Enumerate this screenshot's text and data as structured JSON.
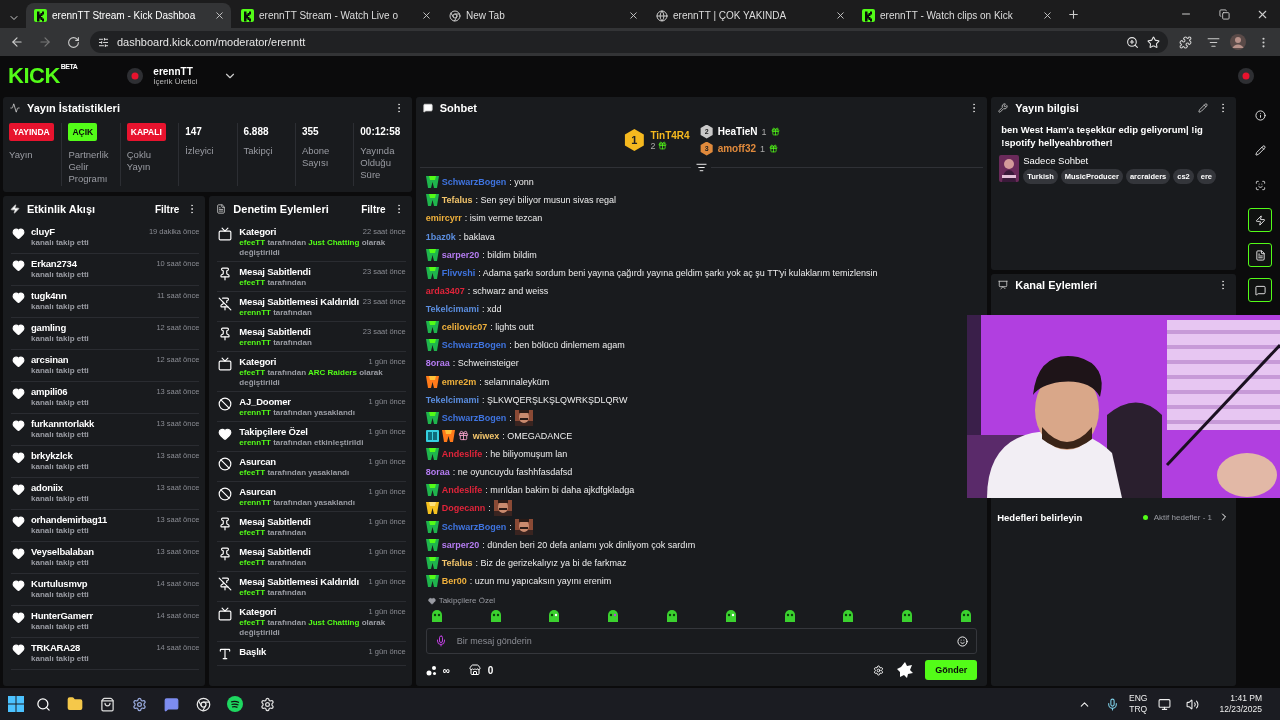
{
  "browser": {
    "tabs": [
      {
        "title": "erennTT Stream - Kick Dashboa",
        "kind": "kick",
        "selected": true
      },
      {
        "title": "erennTT Stream - Watch Live o",
        "kind": "kick",
        "selected": false
      },
      {
        "title": "New Tab",
        "kind": "chrome",
        "selected": false
      },
      {
        "title": "erennTT | ÇOK YAKINDA",
        "kind": "globe",
        "selected": false
      },
      {
        "title": "erennTT - Watch clips on Kick",
        "kind": "kick",
        "selected": false
      }
    ],
    "url": "dashboard.kick.com/moderator/erenntt"
  },
  "header": {
    "logo": "KICK",
    "logo_tag": "BETA",
    "user": "erennTT",
    "role": "İçerik Üretici"
  },
  "stats": {
    "title": "Yayın İstatistikleri",
    "items": [
      {
        "kind": "badge",
        "badge": "YAYINDA",
        "color": "#e8132e",
        "label": "Yayın"
      },
      {
        "kind": "badge",
        "badge": "AÇIK",
        "color": "#53fc18",
        "label": "Partnerlik Gelir Programı"
      },
      {
        "kind": "badge",
        "badge": "KAPALI",
        "color": "#e8132e",
        "label": "Çoklu Yayın"
      },
      {
        "kind": "value",
        "value": "147",
        "label": "İzleyici"
      },
      {
        "kind": "value",
        "value": "6.888",
        "label": "Takipçi"
      },
      {
        "kind": "value",
        "value": "355",
        "label": "Abone Sayısı"
      },
      {
        "kind": "value",
        "value": "00:12:58",
        "label": "Yayında Olduğu Süre"
      }
    ]
  },
  "activity": {
    "title": "Etkinlik Akışı",
    "filter": "Filtre",
    "items": [
      {
        "user": "cluyF",
        "text": "kanalı takip etti",
        "time": "19 dakika önce"
      },
      {
        "user": "Erkan2734",
        "text": "kanalı takip etti",
        "time": "10 saat önce"
      },
      {
        "user": "tugk4nn",
        "text": "kanalı takip etti",
        "time": "11 saat önce"
      },
      {
        "user": "gamling",
        "text": "kanalı takip etti",
        "time": "12 saat önce"
      },
      {
        "user": "arcsinan",
        "text": "kanalı takip etti",
        "time": "12 saat önce"
      },
      {
        "user": "ampili06",
        "text": "kanalı takip etti",
        "time": "13 saat önce"
      },
      {
        "user": "furkanntorlakk",
        "text": "kanalı takip etti",
        "time": "13 saat önce"
      },
      {
        "user": "brkykzlck",
        "text": "kanalı takip etti",
        "time": "13 saat önce"
      },
      {
        "user": "adoniix",
        "text": "kanalı takip etti",
        "time": "13 saat önce"
      },
      {
        "user": "orhandemirbag11",
        "text": "kanalı takip etti",
        "time": "13 saat önce"
      },
      {
        "user": "Veyselbalaban",
        "text": "kanalı takip etti",
        "time": "13 saat önce"
      },
      {
        "user": "Kurtulusmvp",
        "text": "kanalı takip etti",
        "time": "14 saat önce"
      },
      {
        "user": "HunterGamerr",
        "text": "kanalı takip etti",
        "time": "14 saat önce"
      },
      {
        "user": "TRKARA28",
        "text": "kanalı takip etti",
        "time": "14 saat önce"
      }
    ]
  },
  "moderation": {
    "title": "Denetim Eylemleri",
    "filter": "Filtre",
    "items": [
      {
        "kind": "category",
        "title": "Kategori",
        "time": "22 saat önce",
        "actor": "efeeTT",
        "text": "tarafından",
        "target": "Just Chatting",
        "suffix": "olarak değiştirildi"
      },
      {
        "kind": "pin",
        "title": "Mesaj Sabitlendi",
        "time": "23 saat önce",
        "actor": "efeeTT",
        "text": "tarafından"
      },
      {
        "kind": "unpin",
        "title": "Mesaj Sabitlemesi Kaldırıldı",
        "time": "23 saat önce",
        "actor": "erennTT",
        "text": "tarafından"
      },
      {
        "kind": "pin",
        "title": "Mesaj Sabitlendi",
        "time": "23 saat önce",
        "actor": "erennTT",
        "text": "tarafından"
      },
      {
        "kind": "category",
        "title": "Kategori",
        "time": "1 gün önce",
        "actor": "efeeTT",
        "text": "tarafından",
        "target": "ARC Raiders",
        "suffix": "olarak değiştirildi"
      },
      {
        "kind": "ban",
        "title": "AJ_Doomer",
        "time": "1 gün önce",
        "actor": "erennTT",
        "text": "tarafından yasaklandı"
      },
      {
        "kind": "heart",
        "title": "Takipçilere Özel",
        "time": "1 gün önce",
        "actor": "erennTT",
        "text": "tarafından etkinleştirildi"
      },
      {
        "kind": "ban",
        "title": "Asurcan",
        "time": "1 gün önce",
        "actor": "efeeTT",
        "text": "tarafından yasaklandı"
      },
      {
        "kind": "ban",
        "title": "Asurcan",
        "time": "1 gün önce",
        "actor": "erennTT",
        "text": "tarafından yasaklandı"
      },
      {
        "kind": "pin",
        "title": "Mesaj Sabitlendi",
        "time": "1 gün önce",
        "actor": "efeeTT",
        "text": "tarafından"
      },
      {
        "kind": "pin",
        "title": "Mesaj Sabitlendi",
        "time": "1 gün önce",
        "actor": "efeeTT",
        "text": "tarafından"
      },
      {
        "kind": "unpin",
        "title": "Mesaj Sabitlemesi Kaldırıldı",
        "time": "1 gün önce",
        "actor": "efeeTT",
        "text": "tarafından"
      },
      {
        "kind": "category",
        "title": "Kategori",
        "time": "1 gün önce",
        "actor": "efeeTT",
        "text": "tarafından",
        "target": "Just Chatting",
        "suffix": "olarak değiştirildi"
      },
      {
        "kind": "title",
        "title": "Başlık",
        "time": "1 gün önce"
      }
    ]
  },
  "chat": {
    "title": "Sohbet",
    "leaders": [
      {
        "rank": "1",
        "name": "TinT4R4",
        "count": "2",
        "color": "#f5b91f"
      },
      {
        "rank": "2",
        "name": "HeaTieN",
        "count": "1",
        "color": "#c9c9c9"
      },
      {
        "rank": "3",
        "name": "amoff32",
        "count": "1",
        "color": "#e08a3c"
      }
    ],
    "messages": [
      {
        "badges": [
          {
            "kind": "sub"
          }
        ],
        "user": "SchwarzBogen",
        "color": "#3f74e0",
        "kind": "text",
        "text": ": yonn"
      },
      {
        "badges": [
          {
            "kind": "sub"
          }
        ],
        "user": "Tefalus",
        "color": "#f2c46b",
        "kind": "text",
        "text": ": Sen şeyi biliyor musun sivas regal"
      },
      {
        "user": "emircyrr",
        "color": "#f0b13c",
        "kind": "text",
        "text": ": isim verme tezcan"
      },
      {
        "user": "1baz0k",
        "color": "#5b8ee0",
        "kind": "text",
        "text": ": baklava"
      },
      {
        "badges": [
          {
            "kind": "sub"
          }
        ],
        "user": "sarper20",
        "color": "#b57cf2",
        "kind": "text",
        "text": ": bildim bildim"
      },
      {
        "badges": [
          {
            "kind": "sub"
          }
        ],
        "user": "Flivvshi",
        "color": "#3f74e0",
        "kind": "text",
        "text": ": Adama şarkı sordum beni yayına çağırdı yayına geldim şarkı yok aç şu TT'yi kulaklarım temizlensin"
      },
      {
        "user": "arda3407",
        "color": "#e0243a",
        "kind": "text",
        "text": ": schwarz and weiss"
      },
      {
        "user": "Tekelcimami",
        "color": "#5b8ee0",
        "kind": "text",
        "text": ": xdd"
      },
      {
        "badges": [
          {
            "kind": "sub"
          }
        ],
        "user": "celilovic07",
        "color": "#f0b13c",
        "kind": "text",
        "text": ": lights outt"
      },
      {
        "badges": [
          {
            "kind": "sub"
          }
        ],
        "user": "SchwarzBogen",
        "color": "#3f74e0",
        "kind": "text",
        "text": ": ben bölücü dinlemem agam"
      },
      {
        "user": "8oraa",
        "color": "#b57cf2",
        "kind": "text",
        "text": ": Schweinsteiger"
      },
      {
        "badges": [
          {
            "kind": "sub_gold"
          }
        ],
        "user": "emre2m",
        "color": "#f0b13c",
        "kind": "text",
        "text": ": selamınaleyküm"
      },
      {
        "user": "Tekelcimami",
        "color": "#5b8ee0",
        "kind": "text",
        "text": ": ŞLKWQERŞLKŞLQWRKŞDLQRW"
      },
      {
        "badges": [
          {
            "kind": "sub"
          }
        ],
        "user": "SchwarzBogen",
        "color": "#3f74e0",
        "kind": "emote",
        "text": ":"
      },
      {
        "badges": [
          {
            "kind": "og"
          },
          {
            "kind": "sub_gold"
          },
          {
            "kind": "gift"
          }
        ],
        "user": "wiwex",
        "color": "#f2c46b",
        "kind": "text",
        "text": ": OMEGADANCE"
      },
      {
        "badges": [
          {
            "kind": "sub"
          }
        ],
        "user": "Andeslife",
        "color": "#e0243a",
        "kind": "text",
        "text": ": he biliyomuşum lan"
      },
      {
        "user": "8oraa",
        "color": "#b57cf2",
        "kind": "text",
        "text": ": ne oyuncuydu fashhfasdafsd"
      },
      {
        "badges": [
          {
            "kind": "sub"
          }
        ],
        "user": "Andeslife",
        "color": "#e0243a",
        "kind": "text",
        "text": ": mırıldan bakim bi daha ajkdfgkladga"
      },
      {
        "badges": [
          {
            "kind": "sub_yellow"
          }
        ],
        "user": "Dogecann",
        "color": "#e0243a",
        "kind": "emote",
        "text": ":"
      },
      {
        "badges": [
          {
            "kind": "sub"
          }
        ],
        "user": "SchwarzBogen",
        "color": "#3f74e0",
        "kind": "emote",
        "text": ":"
      },
      {
        "badges": [
          {
            "kind": "sub"
          }
        ],
        "user": "sarper20",
        "color": "#b57cf2",
        "kind": "text",
        "text": ": dünden beri 20 defa anlamı yok dinliyom çok sardım"
      },
      {
        "badges": [
          {
            "kind": "sub"
          }
        ],
        "user": "Tefalus",
        "color": "#f2c46b",
        "kind": "text",
        "text": ": Biz de gerizekalıyız ya bi de farkmaz"
      },
      {
        "badges": [
          {
            "kind": "sub"
          }
        ],
        "user": "Ber00",
        "color": "#f0b13c",
        "kind": "text",
        "text": ": uzun mu yapıcaksın yayını erenim"
      }
    ],
    "mode": "Takipçilere Özel",
    "placeholder": "Bir mesaj gönderin",
    "points": "∞",
    "store_count": "0",
    "send": "Gönder"
  },
  "stream_info": {
    "title": "Yayın bilgisi",
    "stream_title": "ben West Ham'a teşekkür edip geliyorum| !ig !spotify hellyeahbrother!",
    "category": "Sadece Sohbet",
    "tags": [
      "Turkish",
      "MusicProducer",
      "arcraiders",
      "cs2",
      "ere"
    ]
  },
  "channel_actions": {
    "title": "Kanal Eylemleri",
    "goal_label": "Hedefleri belirleyin",
    "goal_status": "Aktif hedefler - 1"
  },
  "rail": [
    {
      "kind": "info",
      "active": false
    },
    {
      "kind": "edit",
      "active": false
    },
    {
      "kind": "capture",
      "active": false
    },
    {
      "kind": "bolt",
      "active": true
    },
    {
      "kind": "doc",
      "active": true
    },
    {
      "kind": "chat",
      "active": true
    }
  ],
  "taskbar": {
    "lang": "ENG",
    "layout": "TRQ",
    "time": "1:41 PM",
    "date": "12/23/2025"
  }
}
